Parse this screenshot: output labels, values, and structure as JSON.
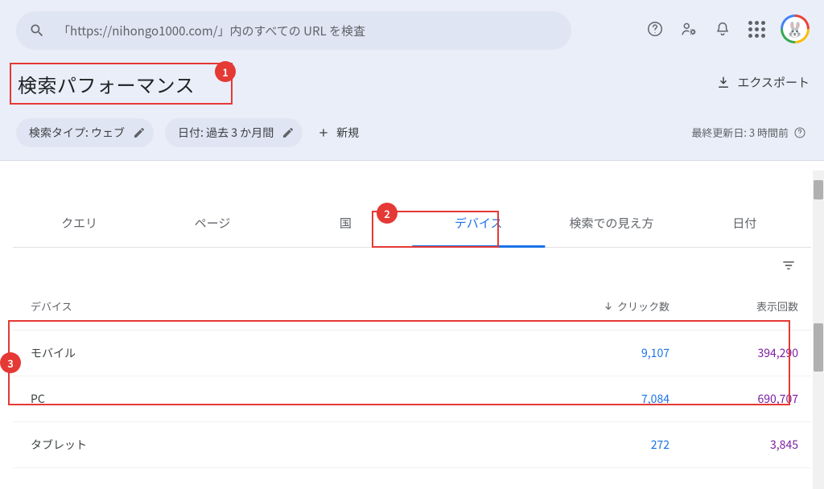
{
  "search": {
    "placeholder": "「https://nihongo1000.com/」内のすべての URL を検査"
  },
  "header": {
    "page_title": "検索パフォーマンス",
    "export_label": "エクスポート"
  },
  "filters": {
    "search_type": "検索タイプ: ウェブ",
    "date_range": "日付: 過去 3 か月間",
    "add_new": "新規",
    "last_updated": "最終更新日: 3 時間前"
  },
  "tabs": [
    {
      "label": "クエリ"
    },
    {
      "label": "ページ"
    },
    {
      "label": "国"
    },
    {
      "label": "デバイス"
    },
    {
      "label": "検索での見え方"
    },
    {
      "label": "日付"
    }
  ],
  "table": {
    "headers": {
      "device": "デバイス",
      "clicks": "クリック数",
      "impressions": "表示回数"
    },
    "rows": [
      {
        "device": "モバイル",
        "clicks": "9,107",
        "impressions": "394,290"
      },
      {
        "device": "PC",
        "clicks": "7,084",
        "impressions": "690,707"
      },
      {
        "device": "タブレット",
        "clicks": "272",
        "impressions": "3,845"
      }
    ]
  },
  "annotations": {
    "b1": "1",
    "b2": "2",
    "b3": "3"
  }
}
